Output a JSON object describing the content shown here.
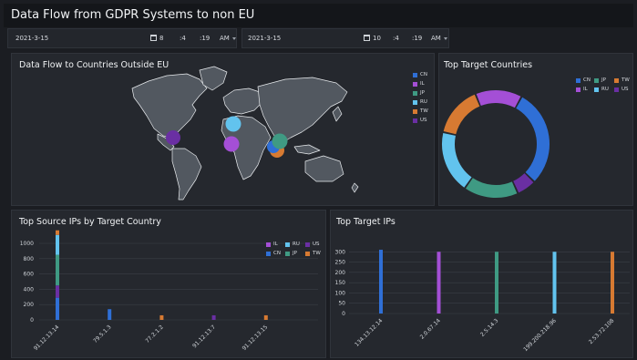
{
  "header": {
    "title": "Data Flow from GDPR Systems to non EU"
  },
  "time_range": {
    "start": {
      "date": "2021-3-15",
      "hour": "8",
      "minute": ":4",
      "second": ":19",
      "ampm": "AM"
    },
    "end": {
      "date": "2021-3-15",
      "hour": "10",
      "minute": ":4",
      "second": ":19",
      "ampm": "AM"
    }
  },
  "colors": {
    "CN": "#2f6fd6",
    "IL": "#a44fd6",
    "JP": "#3f9a83",
    "RU": "#62c3ee",
    "TW": "#d77a32",
    "US": "#6a2fa3"
  },
  "map_panel": {
    "title": "Data Flow to Countries Outside EU",
    "legend": [
      "CN",
      "IL",
      "JP",
      "RU",
      "TW",
      "US"
    ]
  },
  "donut_panel": {
    "title": "Top Target Countries",
    "legend": [
      "CN",
      "JP",
      "TW",
      "IL",
      "RU",
      "US"
    ],
    "chart_data": {
      "type": "pie",
      "categories": [
        "CN",
        "US",
        "JP",
        "RU",
        "TW",
        "IL"
      ],
      "values": [
        25,
        5,
        14,
        16,
        13,
        12
      ]
    }
  },
  "source_panel": {
    "title": "Top Source IPs by Target Country",
    "legend": [
      "IL",
      "RU",
      "US",
      "CN",
      "JP",
      "TW"
    ],
    "chart_data": {
      "type": "bar",
      "categories": [
        "91.12.13.14",
        "79.5.1.3",
        "77.2.1.2",
        "91.12.13.7",
        "91.12.13.15"
      ],
      "stacked_segments": [
        [
          [
            "CN",
            290
          ],
          [
            "US",
            160
          ],
          [
            "JP",
            400
          ],
          [
            "RU",
            260
          ],
          [
            "TW",
            60
          ]
        ],
        [
          [
            "CN",
            140
          ]
        ],
        [
          [
            "TW",
            60
          ]
        ],
        [
          [
            "US",
            60
          ]
        ],
        [
          [
            "TW",
            60
          ]
        ]
      ],
      "yticks": [
        0,
        200,
        400,
        600,
        800,
        1000
      ],
      "ylim": [
        0,
        1000
      ]
    }
  },
  "ips_panel": {
    "title": "Top Target IPs",
    "chart_data": {
      "type": "bar",
      "categories": [
        "134.13.12.14",
        "2.0.67.14",
        "2.5.14.3",
        "199.200.218.96",
        "2.53.72.108"
      ],
      "values": [
        310,
        300,
        300,
        300,
        300
      ],
      "bar_colors": [
        "CN",
        "IL",
        "JP",
        "RU",
        "TW"
      ],
      "yticks": [
        0,
        50,
        100,
        150,
        200,
        250,
        300
      ],
      "ylim": [
        0,
        350
      ]
    }
  }
}
